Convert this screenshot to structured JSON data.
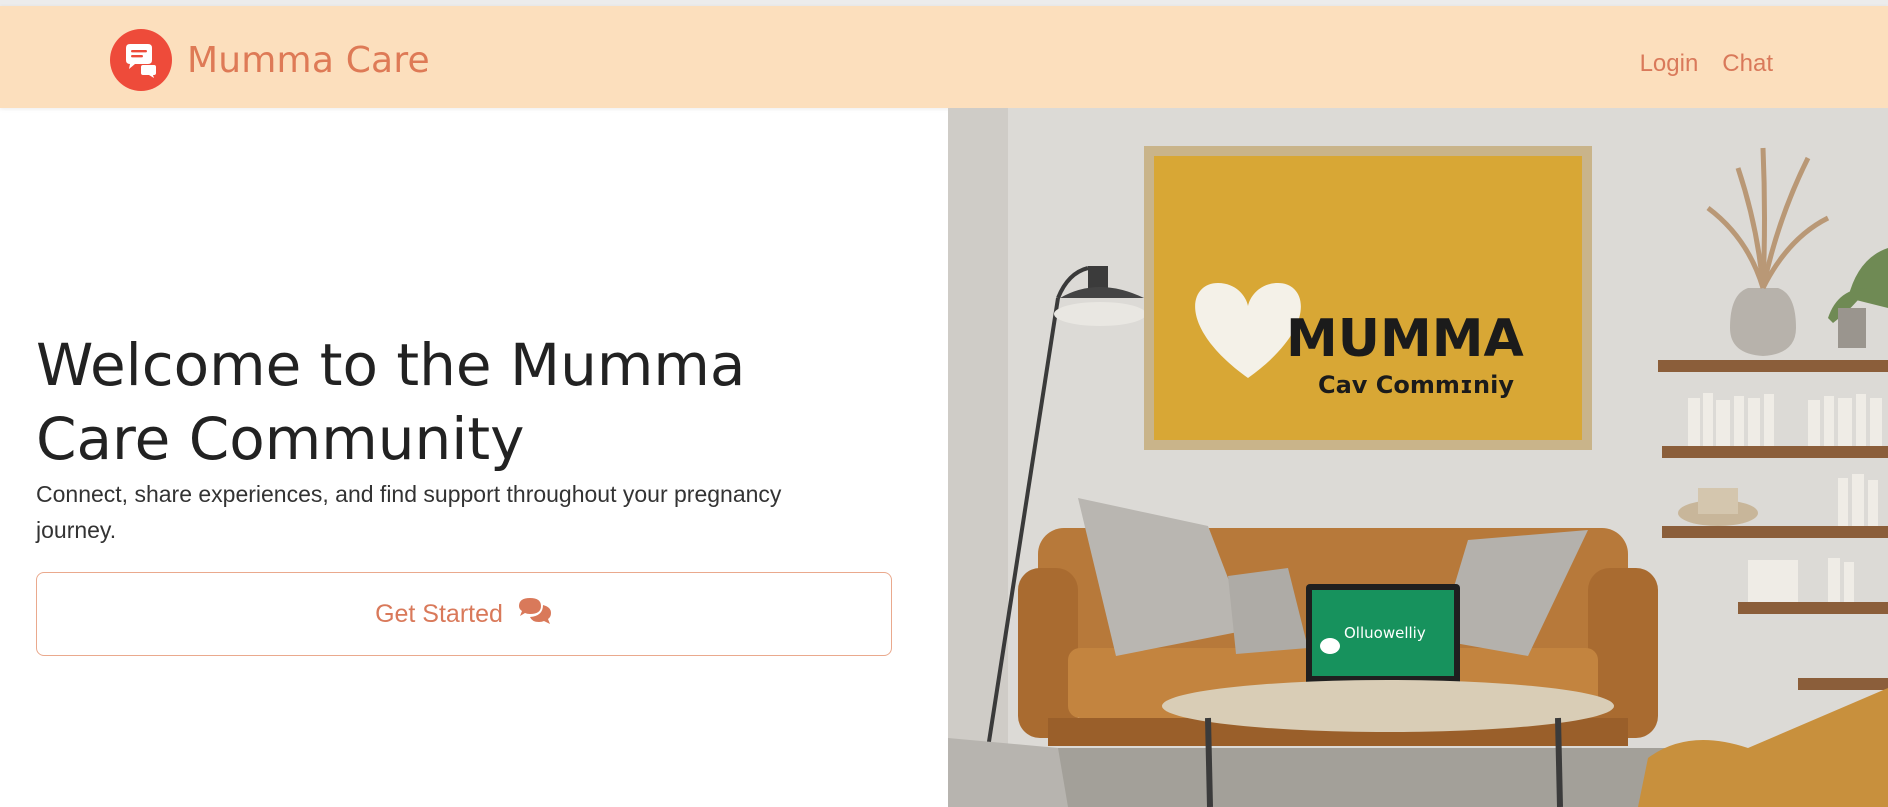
{
  "navbar": {
    "brand_name": "Mumma Care",
    "logo_icon": "chat-bubbles-icon",
    "links": [
      {
        "label": "Login"
      },
      {
        "label": "Chat"
      }
    ]
  },
  "hero": {
    "title": "Welcome to the Mumma Care Community",
    "subtitle": "Connect, share experiences, and find support throughout your pregnancy journey.",
    "cta_label": "Get Started",
    "cta_icon": "comments-icon"
  },
  "colors": {
    "navbar_bg": "#fcdfbd",
    "accent": "#d9795a",
    "logo_bg": "#ee4b3a"
  }
}
